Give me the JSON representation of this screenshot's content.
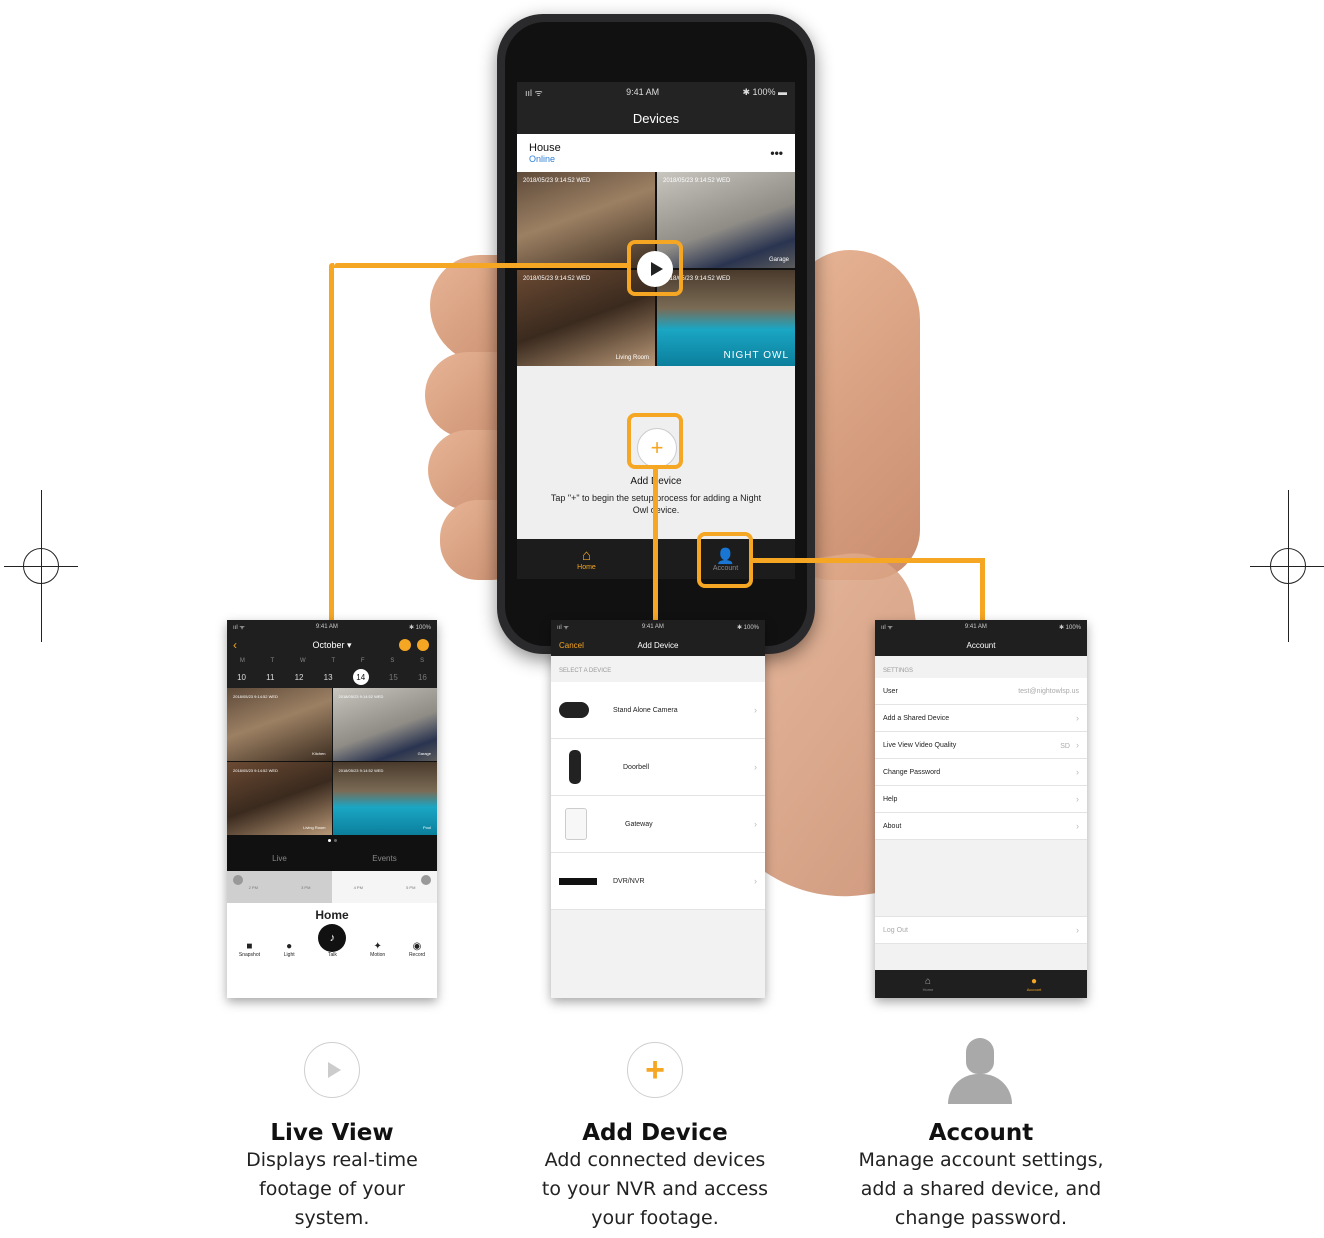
{
  "phone": {
    "status": {
      "signal": "ııl ᯤ",
      "time": "9:41 AM",
      "battery": "✱ 100% ▬"
    },
    "nav_title": "Devices",
    "device": {
      "name": "House",
      "status": "Online",
      "menu": "•••"
    },
    "cameras": [
      {
        "timestamp": "2018/05/23 9:14:52 WED",
        "label": ""
      },
      {
        "timestamp": "2018/05/23 9:14:52 WED",
        "label": "Garage"
      },
      {
        "timestamp": "2018/05/23 9:14:52 WED",
        "label": "Living Room"
      },
      {
        "timestamp": "2018/05/23 9:14:52 WED",
        "label": "NIGHT OWL"
      }
    ],
    "add_device": {
      "title": "Add Device",
      "hint": "Tap \"+\" to begin the setup process for adding a Night Owl device."
    },
    "tabs": [
      {
        "label": "Home"
      },
      {
        "label": "Account"
      }
    ]
  },
  "live_view": {
    "status": {
      "left": "ııl ᯤ",
      "time": "9:41 AM",
      "battery": "✱ 100%"
    },
    "month": "October ▾",
    "weekdays": [
      "M",
      "T",
      "W",
      "T",
      "F",
      "S",
      "S"
    ],
    "days": [
      "10",
      "11",
      "12",
      "13",
      "14",
      "15",
      "16"
    ],
    "selected_day": "14",
    "cam_labels": [
      "Kitchen",
      "Garage",
      "Living Room",
      "Pool"
    ],
    "cam_timestamp": "2018/05/23 9:14:52 WED",
    "segments": [
      "Live",
      "Events"
    ],
    "timeline": [
      "2 PM",
      "3 PM",
      "4 PM",
      "5 PM"
    ],
    "title": "Home",
    "actions": [
      {
        "label": "Snapshot",
        "icon": "camera-icon"
      },
      {
        "label": "Light",
        "icon": "bulb-icon"
      },
      {
        "label": "Talk",
        "icon": "microphone-icon"
      },
      {
        "label": "Motion",
        "icon": "motion-icon"
      },
      {
        "label": "Record",
        "icon": "record-icon"
      }
    ]
  },
  "add_device_screen": {
    "status": {
      "left": "ııl ᯤ",
      "time": "9:41 AM",
      "battery": "✱ 100%"
    },
    "cancel": "Cancel",
    "title": "Add Device",
    "section": "SELECT A DEVICE",
    "items": [
      {
        "label": "Stand Alone Camera",
        "icon": "camera-device-icon"
      },
      {
        "label": "Doorbell",
        "icon": "doorbell-icon"
      },
      {
        "label": "Gateway",
        "icon": "gateway-icon"
      },
      {
        "label": "DVR/NVR",
        "icon": "dvr-icon"
      }
    ]
  },
  "account_screen": {
    "status": {
      "left": "ııl ᯤ",
      "time": "9:41 AM",
      "battery": "✱ 100%"
    },
    "title": "Account",
    "section": "SETTINGS",
    "rows": [
      {
        "label": "User",
        "value": "test@nightowlsp.us"
      },
      {
        "label": "Add a Shared Device",
        "value": ""
      },
      {
        "label": "Live View Video Quality",
        "value": "SD"
      },
      {
        "label": "Change Password",
        "value": ""
      },
      {
        "label": "Help",
        "value": ""
      },
      {
        "label": "About",
        "value": ""
      }
    ],
    "logout": "Log Out",
    "tabs": [
      {
        "label": "Home"
      },
      {
        "label": "Account"
      }
    ]
  },
  "captions": [
    {
      "title": "Live View",
      "desc": [
        "Displays real-time",
        "footage of your",
        "system."
      ]
    },
    {
      "title": "Add Device",
      "desc": [
        "Add connected devices",
        "to your NVR and access",
        "your footage."
      ]
    },
    {
      "title": "Account",
      "desc": [
        "Manage account settings,",
        "add a shared device, and",
        "change password."
      ]
    }
  ],
  "colors": {
    "accent": "#f5a623",
    "dark": "#1f1f1f",
    "link": "#2f7fd6"
  }
}
